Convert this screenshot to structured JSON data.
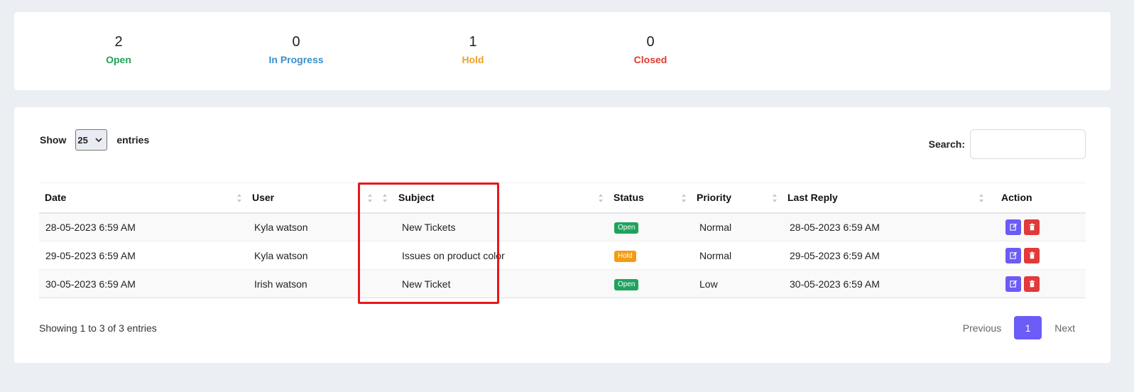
{
  "stats": [
    {
      "count": "2",
      "label": "Open",
      "color": "#20a35a"
    },
    {
      "count": "0",
      "label": "In Progress",
      "color": "#3a8fc8"
    },
    {
      "count": "1",
      "label": "Hold",
      "color": "#f0a02c"
    },
    {
      "count": "0",
      "label": "Closed",
      "color": "#e03a2f"
    }
  ],
  "length": {
    "show_label": "Show",
    "value": "25",
    "entries_label": "entries"
  },
  "search": {
    "label": "Search:",
    "value": ""
  },
  "table": {
    "columns": [
      "Date",
      "User",
      "Subject",
      "Status",
      "Priority",
      "Last Reply",
      "Action"
    ],
    "rows": [
      {
        "date": "28-05-2023 6:59 AM",
        "user": "Kyla watson",
        "subject": "New Tickets",
        "status": "Open",
        "priority": "Normal",
        "last_reply": "28-05-2023 6:59 AM"
      },
      {
        "date": "29-05-2023 6:59 AM",
        "user": "Kyla watson",
        "subject": "Issues on product color",
        "status": "Hold",
        "priority": "Normal",
        "last_reply": "29-05-2023 6:59 AM"
      },
      {
        "date": "30-05-2023 6:59 AM",
        "user": "Irish watson",
        "subject": "New Ticket",
        "status": "Open",
        "priority": "Low",
        "last_reply": "30-05-2023 6:59 AM"
      }
    ]
  },
  "status_colors": {
    "Open": "#1fa35c",
    "Hold": "#f39c12"
  },
  "info": "Showing 1 to 3 of 3 entries",
  "pagination": {
    "previous": "Previous",
    "current": "1",
    "next": "Next"
  },
  "icons": {
    "edit": "edit-icon",
    "delete": "trash-icon",
    "sort": "sort-icon",
    "dropdown": "chevron-down-icon"
  },
  "colors": {
    "accent": "#6b5cf6",
    "danger": "#e03a3a",
    "highlight": "#e8161b"
  }
}
